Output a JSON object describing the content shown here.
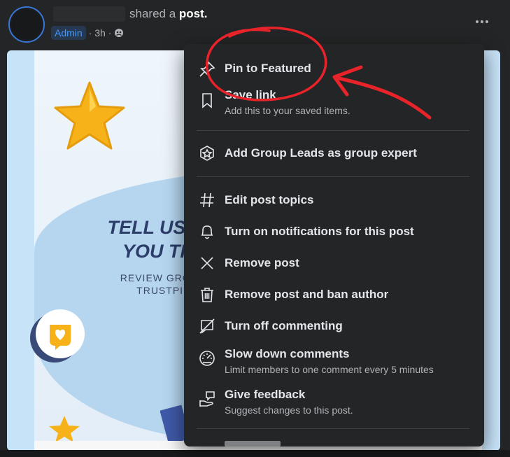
{
  "post": {
    "shared_prefix": "shared a",
    "shared_object": "post.",
    "badge": "Admin",
    "time": "· 3h ·",
    "globe_icon": "group-icon",
    "more_icon": "more-horizontal-icon"
  },
  "image": {
    "headline_line1": "TELL US W",
    "headline_line2": "YOU TH",
    "sub_line1": "REVIEW GROUP",
    "sub_line2": "TRUSTPIL"
  },
  "menu": {
    "items": [
      {
        "label": "Pin to Featured",
        "icon": "pin-icon"
      },
      {
        "label": "Save link",
        "desc": "Add this to your saved items.",
        "icon": "bookmark-icon"
      },
      {
        "label": "Add Group Leads as group expert",
        "icon": "expert-badge-icon"
      },
      {
        "label": "Edit post topics",
        "icon": "hashtag-icon"
      },
      {
        "label": "Turn on notifications for this post",
        "icon": "bell-icon"
      },
      {
        "label": "Remove post",
        "icon": "x-icon"
      },
      {
        "label": "Remove post and ban author",
        "icon": "trash-icon"
      },
      {
        "label": "Turn off commenting",
        "icon": "comment-off-icon"
      },
      {
        "label": "Slow down comments",
        "desc": "Limit members to one comment every 5 minutes",
        "icon": "gauge-icon"
      },
      {
        "label": "Give feedback",
        "desc": "Suggest changes to this post.",
        "icon": "feedback-icon"
      }
    ]
  },
  "colors": {
    "annotation_red": "#e8232a",
    "admin_badge_text": "#4599ff",
    "menu_bg": "#242526"
  }
}
